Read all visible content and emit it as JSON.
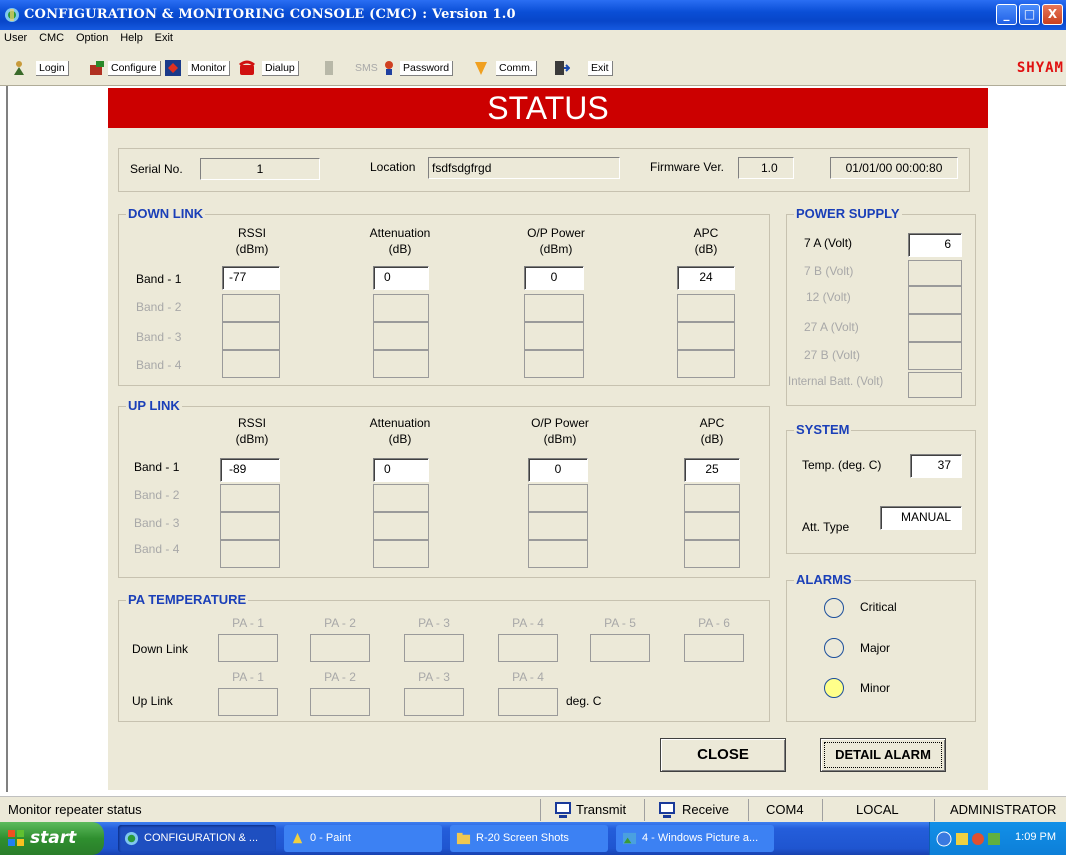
{
  "window": {
    "title": "CONFIGURATION & MONITORING CONSOLE (CMC)  :  Version 1.0",
    "min": "_",
    "max": "□",
    "close": "X"
  },
  "menu": [
    "User",
    "CMC",
    "Option",
    "Help",
    "Exit"
  ],
  "toolbar": {
    "login": "Login",
    "configure": "Configure",
    "monitor": "Monitor",
    "dialup": "Dialup",
    "sms": "SMS",
    "password": "Password",
    "comm": "Comm.",
    "exit": "Exit",
    "brand": "SHYAM"
  },
  "status": {
    "title": "STATUS",
    "serial_label": "Serial No.",
    "serial_value": "1",
    "location_label": "Location",
    "location_value": "fsdfsdgfrgd",
    "firmware_label": "Firmware Ver.",
    "firmware_value": "1.0",
    "datetime": "01/01/00 00:00:80"
  },
  "columns": {
    "rssi": "RSSI",
    "rssi_unit": "(dBm)",
    "att": "Attenuation",
    "att_unit": "(dB)",
    "op": "O/P Power",
    "op_unit": "(dBm)",
    "apc": "APC",
    "apc_unit": "(dB)"
  },
  "downlink": {
    "title": "DOWN LINK",
    "bands": [
      "Band - 1",
      "Band - 2",
      "Band - 3",
      "Band - 4"
    ],
    "band1": {
      "rssi": "-77",
      "att": "0",
      "op": "0",
      "apc": "24"
    }
  },
  "uplink": {
    "title": "UP LINK",
    "bands": [
      "Band - 1",
      "Band - 2",
      "Band - 3",
      "Band - 4"
    ],
    "band1": {
      "rssi": "-89",
      "att": "0",
      "op": "0",
      "apc": "25"
    }
  },
  "power": {
    "title": "POWER SUPPLY",
    "labels": [
      "7 A (Volt)",
      "7 B (Volt)",
      "12 (Volt)",
      "27 A  (Volt)",
      "27 B  (Volt)",
      "Internal Batt. (Volt)"
    ],
    "v7a": "6"
  },
  "system": {
    "title": "SYSTEM",
    "temp_label": "Temp. (deg. C)",
    "temp_value": "37",
    "att_type_label": "Att. Type",
    "att_type_value": "MANUAL"
  },
  "alarms": {
    "title": "ALARMS",
    "critical": "Critical",
    "major": "Major",
    "minor": "Minor"
  },
  "pa": {
    "title": "PA TEMPERATURE",
    "down_label": "Down Link",
    "up_label": "Up Link",
    "down_cols": [
      "PA - 1",
      "PA - 2",
      "PA - 3",
      "PA - 4",
      "PA - 5",
      "PA - 6"
    ],
    "up_cols": [
      "PA - 1",
      "PA - 2",
      "PA - 3",
      "PA - 4"
    ],
    "unit": "deg. C"
  },
  "buttons": {
    "close": "CLOSE",
    "detail_alarm": "DETAIL ALARM"
  },
  "statusbar": {
    "message": "Monitor repeater status",
    "transmit": "Transmit",
    "receive": "Receive",
    "port": "COM4",
    "mode": "LOCAL",
    "user": "ADMINISTRATOR"
  },
  "taskbar": {
    "start": "start",
    "tasks": [
      "CONFIGURATION & ...",
      "0 - Paint",
      "R-20 Screen Shots",
      "4 - Windows Picture a..."
    ],
    "clock": "1:09 PM"
  },
  "colors": {
    "header_red": "#cc0000",
    "group_title_blue": "#1a3fb8",
    "minor_alarm_yellow": "#ffff8a"
  }
}
